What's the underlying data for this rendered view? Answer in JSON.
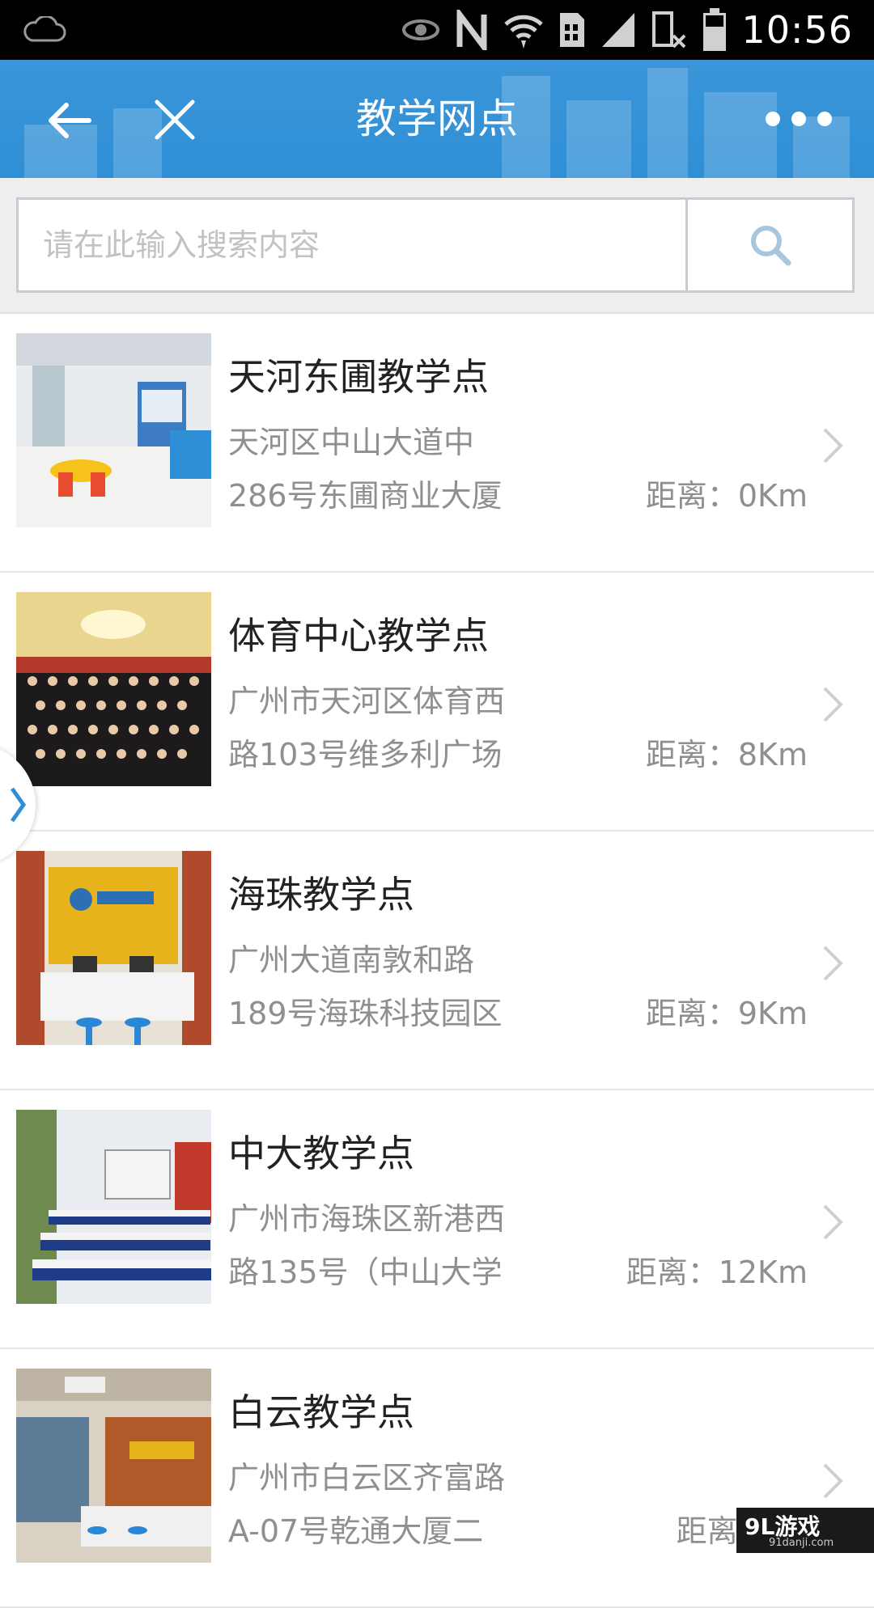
{
  "status_bar": {
    "time": "10:56",
    "icons": [
      "cloud-icon",
      "eye-icon",
      "nfc-icon",
      "wifi-icon",
      "sim-icon",
      "signal-icon",
      "no-data-icon",
      "battery-icon"
    ]
  },
  "header": {
    "title": "教学网点",
    "back_icon": "back-arrow-icon",
    "close_icon": "close-icon",
    "more_icon": "more-dots-icon",
    "color": "#2f8fd6"
  },
  "search": {
    "placeholder": "请在此输入搜索内容",
    "value": "",
    "button_icon": "search-icon"
  },
  "locations": [
    {
      "name": "天河东圃教学点",
      "address_line1": "天河区中山大道中",
      "address_line2": "286号东圃商业大厦",
      "distance": "距离：0Km"
    },
    {
      "name": "体育中心教学点",
      "address_line1": "广州市天河区体育西",
      "address_line2": "路103号维多利广场",
      "distance": "距离：8Km"
    },
    {
      "name": "海珠教学点",
      "address_line1": "广州大道南敦和路",
      "address_line2": "189号海珠科技园区",
      "distance": "距离：9Km"
    },
    {
      "name": "中大教学点",
      "address_line1": "广州市海珠区新港西",
      "address_line2": "路135号（中山大学",
      "distance": "距离：12Km"
    },
    {
      "name": "白云教学点",
      "address_line1": "广州市白云区齐富路",
      "address_line2": "A-07号乾通大厦二",
      "distance": "距离：16"
    }
  ],
  "watermark": {
    "brand": "9L游戏",
    "url": "91danji.com"
  }
}
